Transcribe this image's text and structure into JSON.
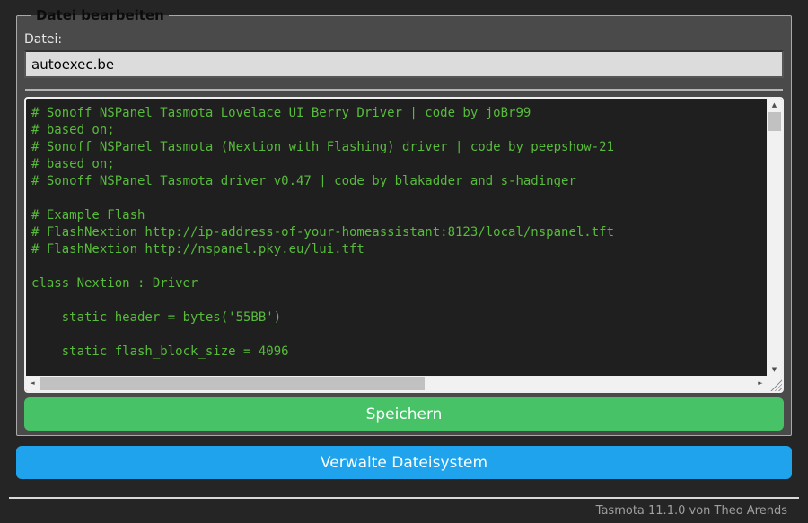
{
  "form": {
    "legend": "Datei bearbeiten",
    "file_label": "Datei:",
    "file_input_value": "autoexec.be",
    "save_button_label": "Speichern"
  },
  "editor": {
    "code_lines": [
      "# Sonoff NSPanel Tasmota Lovelace UI Berry Driver | code by joBr99",
      "# based on;",
      "# Sonoff NSPanel Tasmota (Nextion with Flashing) driver | code by peepshow-21",
      "# based on;",
      "# Sonoff NSPanel Tasmota driver v0.47 | code by blakadder and s-hadinger",
      "",
      "# Example Flash",
      "# FlashNextion http://ip-address-of-your-homeassistant:8123/local/nspanel.tft",
      "# FlashNextion http://nspanel.pky.eu/lui.tft",
      "",
      "class Nextion : Driver",
      "",
      "    static header = bytes('55BB')",
      "",
      "    static flash_block_size = 4096"
    ]
  },
  "actions": {
    "manage_fs_button_label": "Verwalte Dateisystem"
  },
  "footer": {
    "version_text": "Tasmota 11.1.0 von Theo Arends"
  },
  "icons": {
    "scroll_up": "▲",
    "scroll_down": "▼",
    "scroll_left": "◄",
    "scroll_right": "►"
  },
  "colors": {
    "page_background": "#252525",
    "form_background": "#4a4a4a",
    "input_background": "#dcdcdc",
    "console_background": "#1f1f1f",
    "console_text": "#58bb3c",
    "save_button": "#47c266",
    "manage_button": "#1fa3ec",
    "button_text": "#fbffff"
  }
}
